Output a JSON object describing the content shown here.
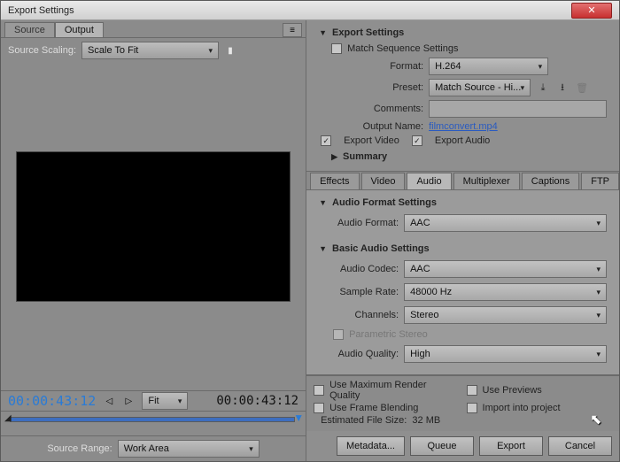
{
  "window": {
    "title": "Export Settings"
  },
  "left": {
    "tabs": {
      "source": "Source",
      "output": "Output"
    },
    "source_scaling_label": "Source Scaling:",
    "source_scaling_value": "Scale To Fit",
    "tc_left": "00:00:43:12",
    "fit_label": "Fit",
    "tc_right": "00:00:43:12",
    "source_range_label": "Source Range:",
    "source_range_value": "Work Area"
  },
  "export": {
    "heading": "Export Settings",
    "match_seq": "Match Sequence Settings",
    "format_label": "Format:",
    "format_value": "H.264",
    "preset_label": "Preset:",
    "preset_value": "Match Source - Hi...",
    "comments_label": "Comments:",
    "comments_value": "",
    "output_name_label": "Output Name:",
    "output_name_value": "filmconvert.mp4",
    "export_video": "Export Video",
    "export_audio": "Export Audio",
    "summary_heading": "Summary"
  },
  "subtabs": {
    "effects": "Effects",
    "video": "Video",
    "audio": "Audio",
    "multiplexer": "Multiplexer",
    "captions": "Captions",
    "ftp": "FTP"
  },
  "audio": {
    "format_heading": "Audio Format Settings",
    "audio_format_label": "Audio Format:",
    "audio_format_value": "AAC",
    "basic_heading": "Basic Audio Settings",
    "codec_label": "Audio Codec:",
    "codec_value": "AAC",
    "sample_label": "Sample Rate:",
    "sample_value": "48000 Hz",
    "channels_label": "Channels:",
    "channels_value": "Stereo",
    "parametric": "Parametric Stereo",
    "quality_label": "Audio Quality:",
    "quality_value": "High"
  },
  "bottom": {
    "use_max": "Use Maximum Render Quality",
    "use_previews": "Use Previews",
    "use_frame_blend": "Use Frame Blending",
    "import_proj": "Import into project",
    "est_label": "Estimated File Size:",
    "est_value": "32 MB",
    "metadata": "Metadata...",
    "queue": "Queue",
    "export": "Export",
    "cancel": "Cancel"
  }
}
